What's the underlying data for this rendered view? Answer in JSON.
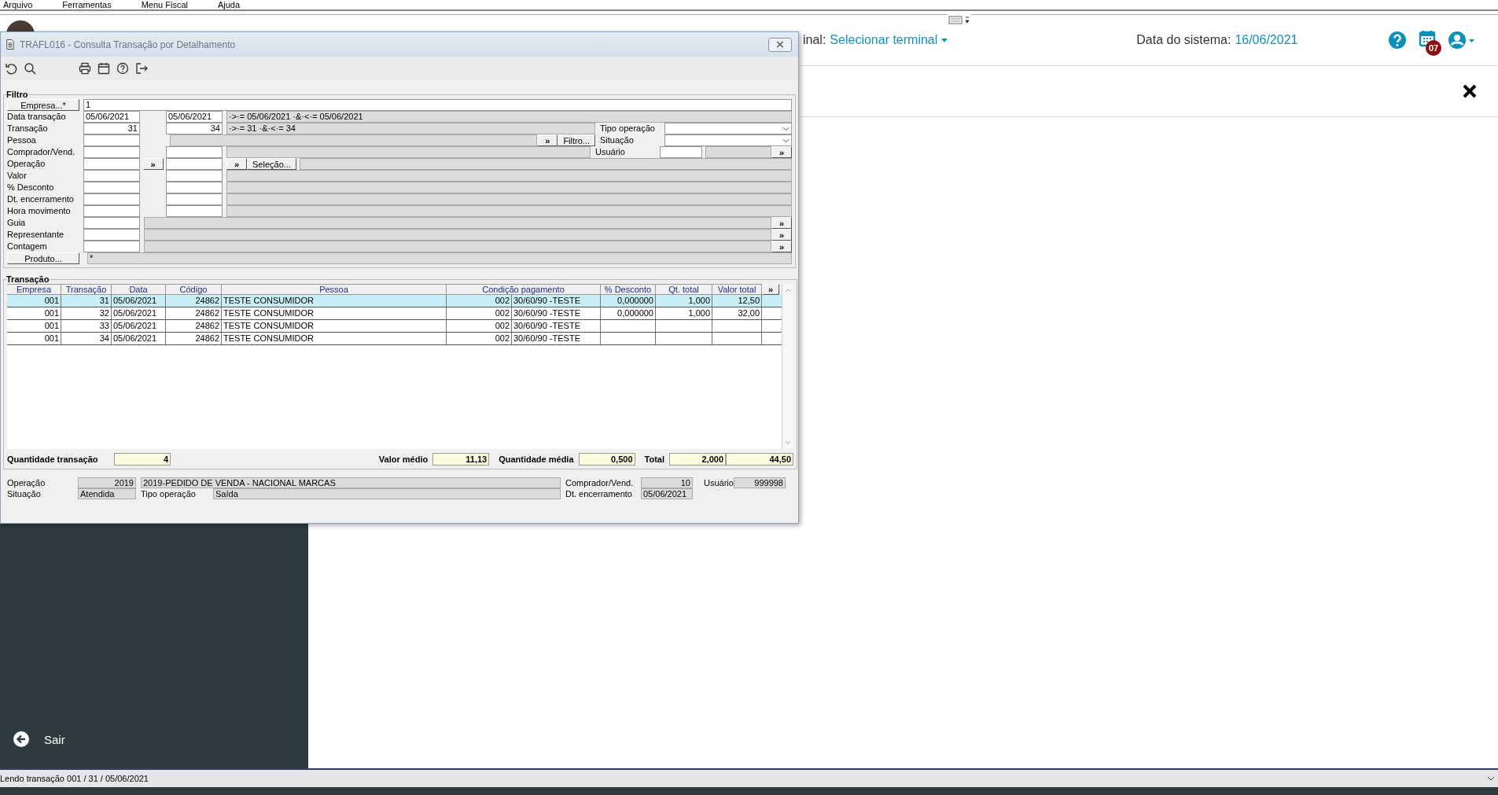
{
  "menu": [
    {
      "label": "Arquivo"
    },
    {
      "label": "Ferramentas"
    },
    {
      "label": "Menu Fiscal"
    },
    {
      "label": "Ajuda"
    }
  ],
  "header": {
    "terminal_label": "inal:",
    "terminal_value": "Selecionar terminal",
    "date_label": "Data do sistema:",
    "date_value": "16/06/2021",
    "calendar_badge": "07"
  },
  "sidebar": {
    "exit_label": "Sair"
  },
  "status_bar": {
    "text": "Lendo transação 001 / 31 / 05/06/2021"
  },
  "dialog": {
    "title": "TRAFL016 - Consulta Transação por Detalhamento",
    "filter": {
      "title": "Filtro",
      "rows": [
        {
          "button": "Empresa...*",
          "cells": [
            {
              "kind": "wide-field",
              "value": "1"
            }
          ]
        },
        {
          "label": "Data transação",
          "cells": [
            {
              "kind": "field",
              "value": "05/06/2021"
            },
            {
              "kind": "spacer"
            },
            {
              "kind": "field",
              "value": "05/06/2021"
            },
            {
              "kind": "readonly",
              "value": "·>·= 05/06/2021 ·&·<·= 05/06/2021"
            }
          ]
        },
        {
          "label": "Transação",
          "cells": [
            {
              "kind": "number-field",
              "value": "31"
            },
            {
              "kind": "spacer"
            },
            {
              "kind": "number-field",
              "value": "34"
            },
            {
              "kind": "readonly",
              "value": "·>·= 31 ·&·<·= 34"
            },
            {
              "kind": "side-label",
              "value": "Tipo operação"
            },
            {
              "kind": "dropdown"
            }
          ]
        },
        {
          "label": "Pessoa",
          "cells": [
            {
              "kind": "field"
            },
            {
              "kind": "spacer"
            },
            {
              "kind": "readonly"
            },
            {
              "kind": "button",
              "value": "»"
            },
            {
              "kind": "button",
              "value": "Filtro..."
            },
            {
              "kind": "side-label",
              "value": "Situação"
            },
            {
              "kind": "dropdown"
            }
          ]
        },
        {
          "label": "Comprador/Vend.",
          "cells": [
            {
              "kind": "field"
            },
            {
              "kind": "spacer"
            },
            {
              "kind": "field"
            },
            {
              "kind": "readonly"
            },
            {
              "kind": "side-label",
              "value": "Usuário"
            },
            {
              "kind": "short-field"
            },
            {
              "kind": "short-readonly"
            },
            {
              "kind": "button",
              "value": "»"
            }
          ]
        },
        {
          "label": "Operação",
          "cells": [
            {
              "kind": "field"
            },
            {
              "kind": "mid-button",
              "value": "»"
            },
            {
              "kind": "field"
            },
            {
              "kind": "button-group",
              "buttons": [
                "»",
                "Seleção..."
              ]
            }
          ]
        },
        {
          "label": "Valor",
          "cells": [
            {
              "kind": "field"
            },
            {
              "kind": "spacer"
            },
            {
              "kind": "field"
            },
            {
              "kind": "readonly"
            }
          ]
        },
        {
          "label": "% Desconto",
          "cells": [
            {
              "kind": "field"
            },
            {
              "kind": "spacer"
            },
            {
              "kind": "field"
            },
            {
              "kind": "readonly"
            }
          ]
        },
        {
          "label": "Dt. encerramento",
          "cells": [
            {
              "kind": "field"
            },
            {
              "kind": "spacer"
            },
            {
              "kind": "field"
            },
            {
              "kind": "readonly"
            }
          ]
        },
        {
          "label": "Hora movimento",
          "cells": [
            {
              "kind": "field"
            },
            {
              "kind": "spacer"
            },
            {
              "kind": "field"
            },
            {
              "kind": "readonly"
            }
          ]
        },
        {
          "label": "Guia",
          "cells": [
            {
              "kind": "field"
            },
            {
              "kind": "readonly"
            },
            {
              "kind": "button",
              "value": "»"
            }
          ]
        },
        {
          "label": "Representante",
          "cells": [
            {
              "kind": "field"
            },
            {
              "kind": "readonly"
            },
            {
              "kind": "button",
              "value": "»"
            }
          ]
        },
        {
          "label": "Contagem",
          "cells": [
            {
              "kind": "field"
            },
            {
              "kind": "readonly"
            },
            {
              "kind": "button",
              "value": "»"
            }
          ]
        },
        {
          "button": "Produto...",
          "cells": [
            {
              "kind": "readonly",
              "value": "*"
            }
          ]
        }
      ]
    },
    "transactions": {
      "title": "Transação",
      "columns": [
        "Empresa",
        "Transação",
        "Data",
        "Código",
        "Pessoa",
        "Condição pagamento",
        "% Desconto",
        "Qt. total",
        "Valor total"
      ],
      "more_button": "»",
      "rows": [
        {
          "selected": true,
          "empresa": "001",
          "transacao": "31",
          "data": "05/06/2021",
          "codigo": "24862",
          "pessoa": "TESTE CONSUMIDOR",
          "condicao_codigo": "002",
          "condicao_descricao": "30/60/90 -TESTE",
          "desconto": "0,000000",
          "qt_total": "1,000",
          "valor_total": "12,50"
        },
        {
          "selected": false,
          "empresa": "001",
          "transacao": "32",
          "data": "05/06/2021",
          "codigo": "24862",
          "pessoa": "TESTE CONSUMIDOR",
          "condicao_codigo": "002",
          "condicao_descricao": "30/60/90 -TESTE",
          "desconto": "0,000000",
          "qt_total": "1,000",
          "valor_total": "32,00"
        },
        {
          "selected": false,
          "empresa": "001",
          "transacao": "33",
          "data": "05/06/2021",
          "codigo": "24862",
          "pessoa": "TESTE CONSUMIDOR",
          "condicao_codigo": "002",
          "condicao_descricao": "30/60/90 -TESTE"
        },
        {
          "selected": false,
          "empresa": "001",
          "transacao": "34",
          "data": "05/06/2021",
          "codigo": "24862",
          "pessoa": "TESTE CONSUMIDOR",
          "condicao_codigo": "002",
          "condicao_descricao": "30/60/90 -TESTE"
        }
      ],
      "totals": [
        {
          "label": "Quantidade transação",
          "values": [
            "4"
          ]
        },
        {
          "label": "Valor médio",
          "values": [
            "11,13"
          ]
        },
        {
          "label": "Quantidade média",
          "values": [
            "0,500"
          ]
        },
        {
          "label": "Total",
          "values": [
            "2,000",
            "44,50"
          ]
        }
      ]
    },
    "details": {
      "operacao": {
        "label": "Operação",
        "code": "2019",
        "description": "2019-PEDIDO DE VENDA - NACIONAL MARCAS"
      },
      "comprador": {
        "label": "Comprador/Vend.",
        "value": "10"
      },
      "usuario": {
        "label": "Usuário",
        "value": "999998"
      },
      "situacao": {
        "label": "Situação",
        "value": "Atendida"
      },
      "tipo_operacao": {
        "label": "Tipo operação",
        "value": "Saída"
      },
      "dt_encerramento": {
        "label": "Dt. encerramento",
        "value": "05/06/2021"
      }
    }
  }
}
